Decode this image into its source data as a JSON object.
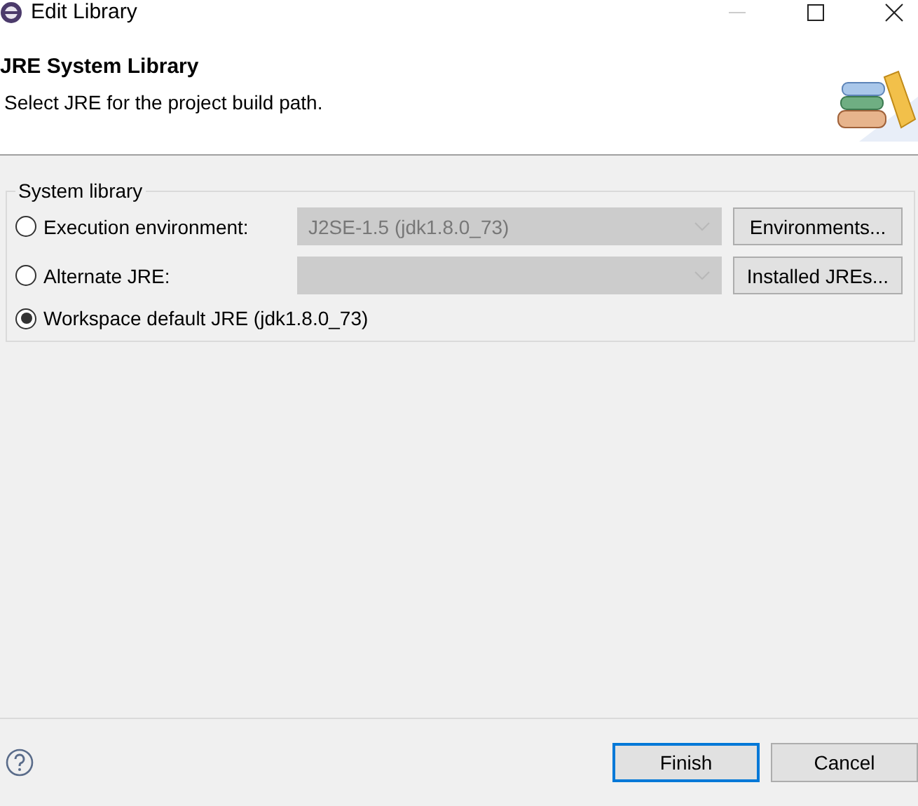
{
  "window": {
    "title": "Edit Library"
  },
  "header": {
    "title": "JRE System Library",
    "description": "Select JRE for the project build path."
  },
  "group": {
    "label": "System library",
    "options": [
      {
        "label": "Execution environment:",
        "selected": false,
        "combo": {
          "value": "J2SE-1.5 (jdk1.8.0_73)",
          "disabled": true
        },
        "button": "Environments..."
      },
      {
        "label": "Alternate JRE:",
        "selected": false,
        "combo": {
          "disabled": true
        },
        "button": "Installed JREs..."
      },
      {
        "label": "Workspace default JRE (jdk1.8.0_73)",
        "selected": true
      }
    ]
  },
  "buttons": [
    {
      "label": "Finish",
      "default": true
    },
    {
      "label": "Cancel",
      "default": false
    }
  ]
}
